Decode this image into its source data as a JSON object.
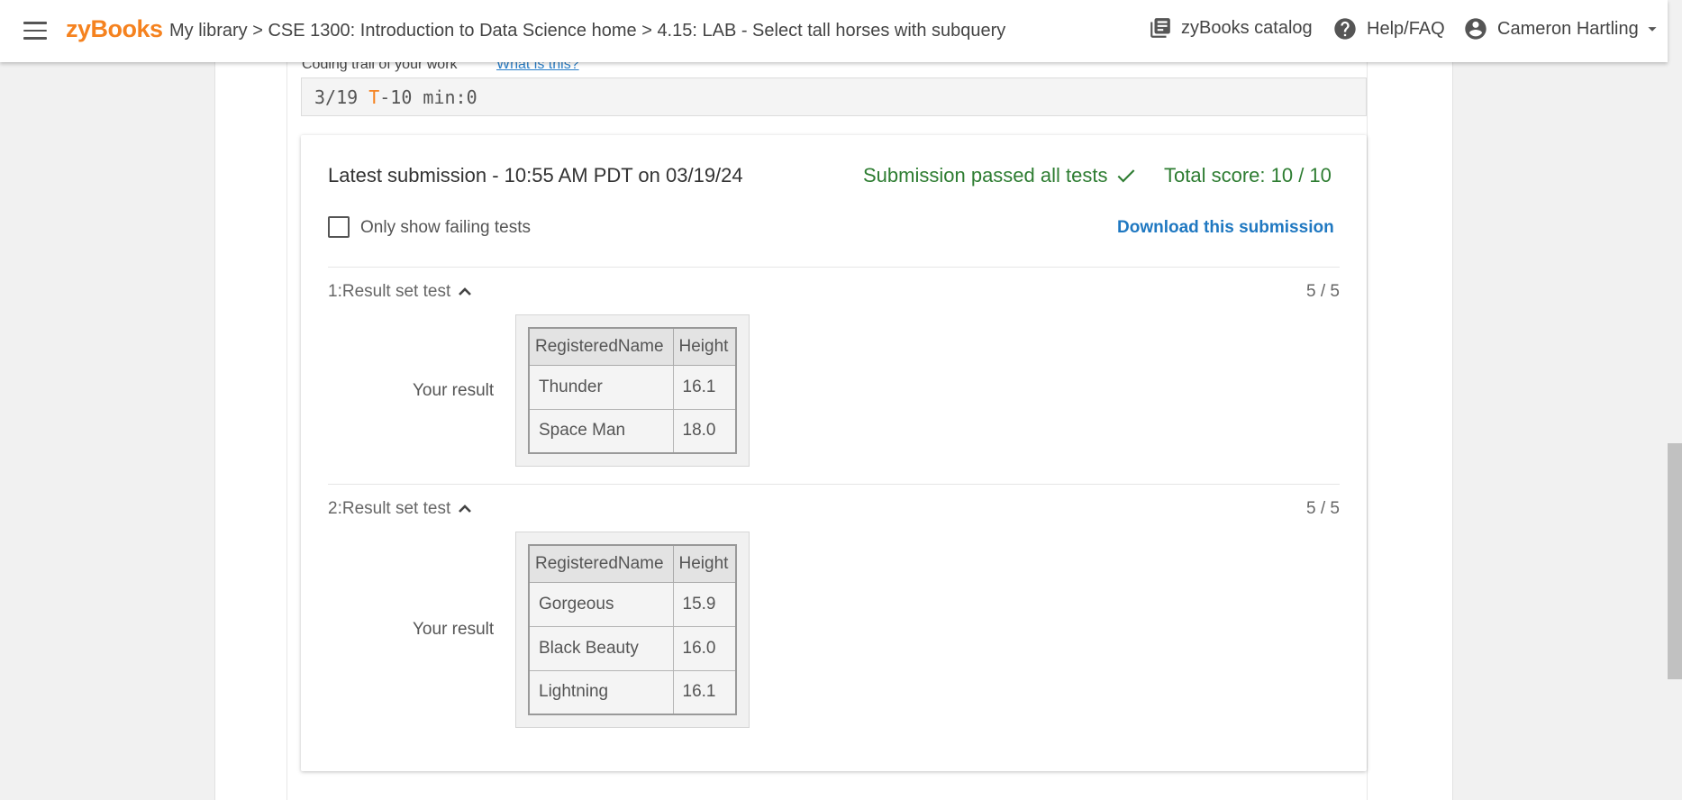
{
  "header": {
    "logo": "zyBooks",
    "breadcrumb": {
      "my_library": "My library",
      "sep1": ">",
      "course": "CSE 1300: Introduction to Data Science home",
      "sep2": ">",
      "section": "4.15: LAB - Select tall horses with subquery"
    },
    "catalog": "zyBooks catalog",
    "help": "Help/FAQ",
    "user": "Cameron Hartling"
  },
  "coding_trail": {
    "label": "Coding trail of your work",
    "link": "What is this?",
    "date": "3/19",
    "t_marker": "T",
    "rest": "-10 min:0"
  },
  "submission": {
    "title": "Latest submission - 10:55 AM PDT on 03/19/24",
    "status": "Submission passed all tests",
    "score": "Total score: 10 / 10",
    "filter_label": "Only show failing tests",
    "filter_checked": false,
    "download": "Download this submission"
  },
  "tests": [
    {
      "title": "1:Result set test",
      "score": "5 / 5",
      "result_label": "Your result",
      "columns": [
        "RegisteredName",
        "Height"
      ],
      "rows": [
        [
          "Thunder",
          "16.1"
        ],
        [
          "Space Man",
          "18.0"
        ]
      ]
    },
    {
      "title": "2:Result set test",
      "score": "5 / 5",
      "result_label": "Your result",
      "columns": [
        "RegisteredName",
        "Height"
      ],
      "rows": [
        [
          "Gorgeous",
          "15.9"
        ],
        [
          "Black Beauty",
          "16.0"
        ],
        [
          "Lightning",
          "16.1"
        ]
      ]
    }
  ],
  "colors": {
    "brand": "#f5821f",
    "pass": "#2e7d32",
    "link": "#1f78c1"
  }
}
